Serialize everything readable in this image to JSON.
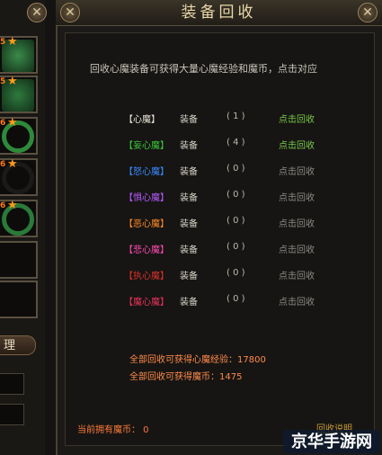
{
  "window": {
    "title": "装备回收",
    "close_glyph": "✕"
  },
  "left_panel": {
    "slots": [
      {
        "level": "5",
        "item": "armor",
        "color": "#3a8a4a"
      },
      {
        "level": "5",
        "item": "boots",
        "color": "#2e7a3e"
      },
      {
        "level": "6",
        "item": "ring",
        "color": "#2e8a3a"
      },
      {
        "level": "6",
        "item": "ring",
        "color": "#1a1a1a"
      },
      {
        "level": "6",
        "item": "ring",
        "color": "#2a7a3a"
      },
      {
        "level": "",
        "item": "empty",
        "color": ""
      },
      {
        "level": "",
        "item": "empty",
        "color": ""
      }
    ],
    "button_label": "理"
  },
  "intro": "回收心魔装备可获得大量心魔经验和魔币，点击对应",
  "rows": [
    {
      "name": "【心魔】",
      "name_color": "#e8e4d8",
      "label": "装备",
      "count": "( 1 )",
      "action": "点击回收",
      "action_color": "#7ac84a"
    },
    {
      "name": "【妄心魔】",
      "name_color": "#3ac83a",
      "label": "装备",
      "count": "( 4 )",
      "action": "点击回收",
      "action_color": "#7ac84a"
    },
    {
      "name": "【怒心魔】",
      "name_color": "#3a8aff",
      "label": "装备",
      "count": "( 0 )",
      "action": "点击回收",
      "action_color": "#8a8a84"
    },
    {
      "name": "【惧心魔】",
      "name_color": "#b85aff",
      "label": "装备",
      "count": "( 0 )",
      "action": "点击回收",
      "action_color": "#8a8a84"
    },
    {
      "name": "【恶心魔】",
      "name_color": "#ff8a2a",
      "label": "装备",
      "count": "( 0 )",
      "action": "点击回收",
      "action_color": "#8a8a84"
    },
    {
      "name": "【悲心魔】",
      "name_color": "#ff4ab0",
      "label": "装备",
      "count": "( 0 )",
      "action": "点击回收",
      "action_color": "#8a8a84"
    },
    {
      "name": "【执心魔】",
      "name_color": "#d8322a",
      "label": "装备",
      "count": "( 0 )",
      "action": "点击回收",
      "action_color": "#8a8a84"
    },
    {
      "name": "【魔心魔】",
      "name_color": "#e8325a",
      "label": "装备",
      "count": "( 0 )",
      "action": "点击回收",
      "action_color": "#8a8a84"
    }
  ],
  "totals": {
    "exp": "全部回收可获得心魔经验：17800",
    "coins": "全部回收可获得魔币：1475"
  },
  "balance": "当前拥有魔币： 0",
  "help_link": "回收说明",
  "watermark": "京华手游网"
}
